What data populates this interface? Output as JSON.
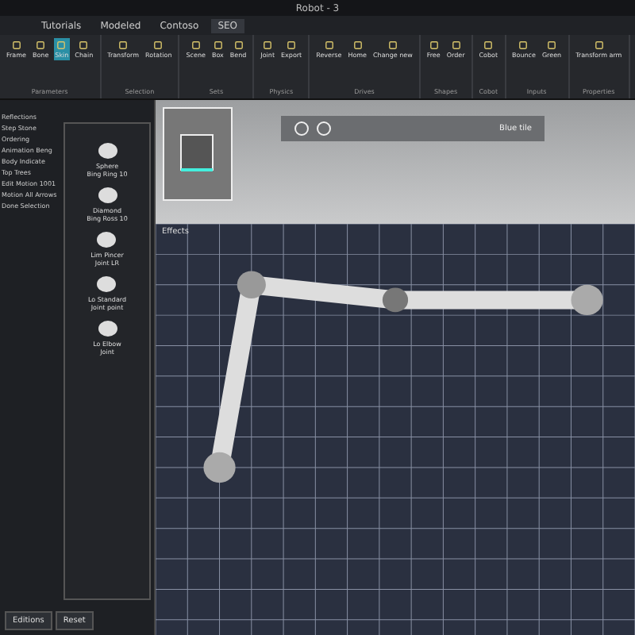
{
  "window": {
    "title": "Robot - 3"
  },
  "tabs": [
    {
      "label": "Tutorials",
      "selected": false
    },
    {
      "label": "Modeled",
      "selected": false
    },
    {
      "label": "Contoso",
      "selected": false
    },
    {
      "label": "SEO",
      "selected": true
    }
  ],
  "ribbon_groups": [
    {
      "label": "Parameters",
      "tools": [
        {
          "label": "Frame"
        },
        {
          "label": "Bone"
        },
        {
          "label": "Skin",
          "selected": true
        },
        {
          "label": "Chain"
        }
      ]
    },
    {
      "label": "Selection",
      "tools": [
        {
          "label": "Transform"
        },
        {
          "label": "Rotation"
        }
      ]
    },
    {
      "label": "Sets",
      "tools": [
        {
          "label": "Scene"
        },
        {
          "label": "Box"
        },
        {
          "label": "Bend"
        }
      ]
    },
    {
      "label": "Physics",
      "tools": [
        {
          "label": "Joint"
        },
        {
          "label": "Export"
        }
      ]
    },
    {
      "label": "Drives",
      "tools": [
        {
          "label": "Reverse"
        },
        {
          "label": "Home"
        },
        {
          "label": "Change new"
        }
      ]
    },
    {
      "label": "Shapes",
      "tools": [
        {
          "label": "Free"
        },
        {
          "label": "Order"
        }
      ]
    },
    {
      "label": "Cobot",
      "tools": [
        {
          "label": "Cobot"
        }
      ]
    },
    {
      "label": "Inputs",
      "tools": [
        {
          "label": "Bounce"
        },
        {
          "label": "Green"
        }
      ]
    },
    {
      "label": "Properties",
      "tools": [
        {
          "label": "Transform arm"
        }
      ]
    }
  ],
  "left_panel": {
    "lines": [
      "Reflections",
      "Step Stone",
      "Ordering",
      "Animation Beng",
      "Body Indicate",
      "Top Trees",
      "Edit Motion 1001",
      "Motion All Arrows",
      "Done Selection"
    ],
    "assets": [
      {
        "name": "Sphere",
        "caption": "Bing Ring 10"
      },
      {
        "name": "Diamond",
        "caption": "Bing Ross 10"
      },
      {
        "name": "Lim Pincer",
        "caption": "Joint LR"
      },
      {
        "name": "Lo Standard",
        "caption": "Joint point"
      },
      {
        "name": "Lo Elbow",
        "caption": "Joint"
      }
    ],
    "buttons": [
      "Editions",
      "Reset"
    ]
  },
  "viewport": {
    "toolbar_label": "Blue tile",
    "label": "Effects"
  }
}
